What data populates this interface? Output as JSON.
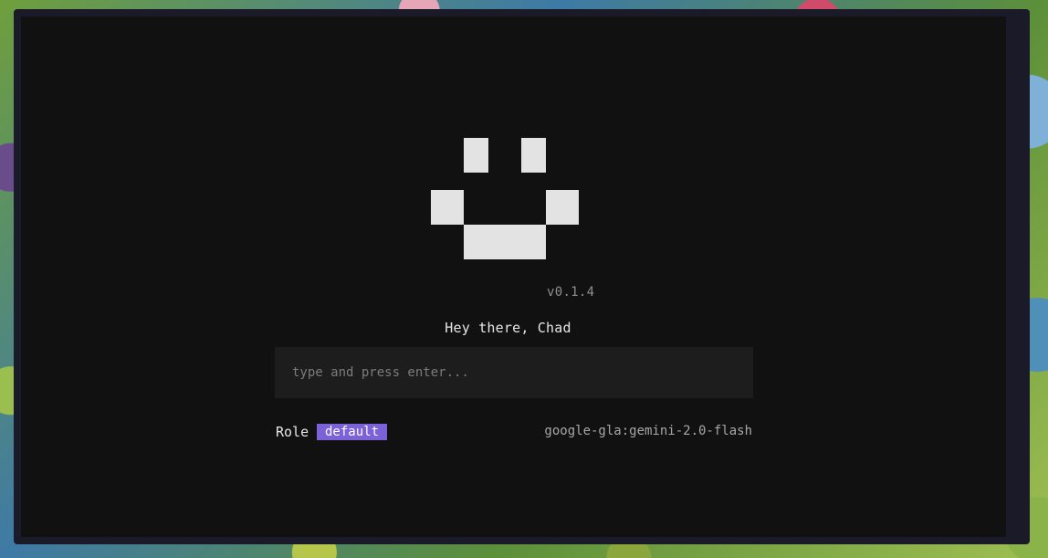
{
  "app": {
    "version": "v0.1.4",
    "greeting": "Hey there, Chad"
  },
  "prompt": {
    "placeholder": "type and press enter...",
    "value": ""
  },
  "status": {
    "role_label": "Role",
    "role_value": "default",
    "model": "google-gla:gemini-2.0-flash"
  },
  "colors": {
    "background": "#111111",
    "accent": "#7b62d9",
    "logo": "#e3e3e3",
    "muted_text": "#8f8f8f"
  },
  "icons": {
    "logo": "pixel-smiley-icon"
  }
}
